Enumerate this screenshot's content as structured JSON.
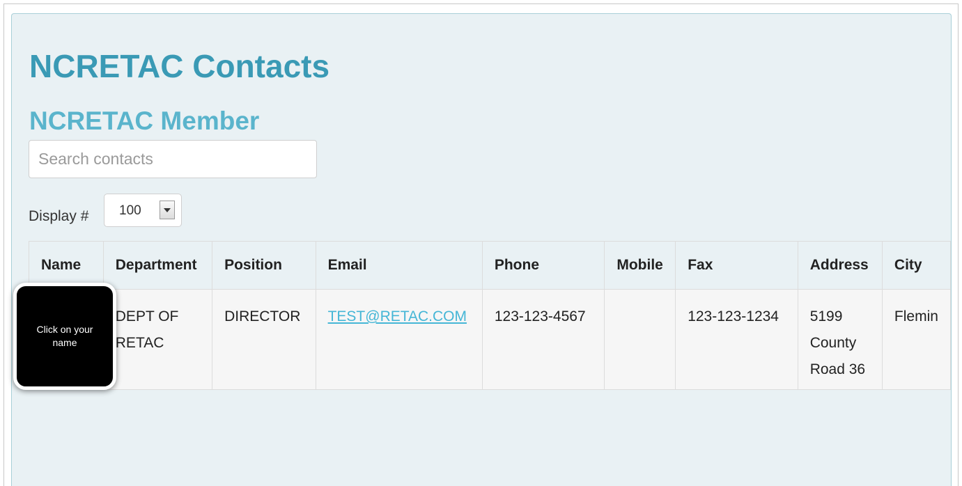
{
  "page": {
    "title": "NCRETAC Contacts",
    "subtitle": "NCRETAC Member"
  },
  "search": {
    "placeholder": "Search contacts",
    "value": ""
  },
  "display": {
    "label": "Display #",
    "selected": "100"
  },
  "table": {
    "headers": [
      "Name",
      "Department",
      "Position",
      "Email",
      "Phone",
      "Mobile",
      "Fax",
      "Address",
      "City"
    ],
    "rows": [
      {
        "name": "",
        "department": "DEPT OF RETAC",
        "position": "DIRECTOR",
        "email": "TEST@RETAC.COM",
        "phone": "123-123-4567",
        "mobile": "",
        "fax": "123-123-1234",
        "address": "5199 County Road 36",
        "city": "Flemin"
      }
    ]
  },
  "callout": {
    "text": "Click on your name"
  },
  "colors": {
    "title": "#3a9ab5",
    "subtitle": "#5ab4cc",
    "panel_background": "#e9f1f4",
    "link": "#45b6d6"
  }
}
